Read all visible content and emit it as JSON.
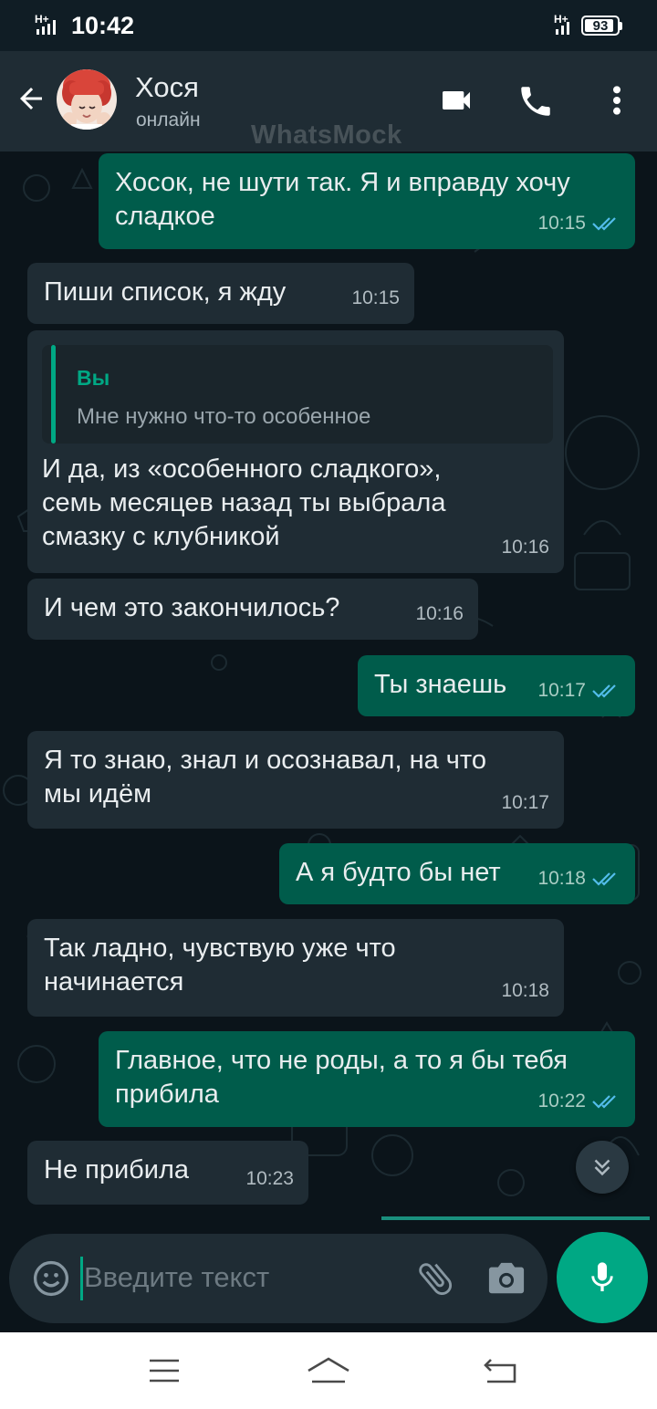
{
  "status_bar": {
    "time": "10:42",
    "network_left": "H+",
    "network_right": "H+",
    "battery": "93",
    "battery_level": 0.93
  },
  "header": {
    "contact_name": "Хося",
    "contact_status": "онлайн",
    "watermark": "WhatsMock"
  },
  "colors": {
    "header_bg": "#1f2c34",
    "chat_bg": "#0b141a",
    "incoming_bubble": "#1f2c34",
    "outgoing_bubble": "#005c4b",
    "accent": "#00a884",
    "read_ticks": "#53bdeb"
  },
  "messages": [
    {
      "direction": "out",
      "lines": [
        "Хосок, не шути так. Я и вправду хочу",
        "сладкое"
      ],
      "time": "10:15",
      "ticks": "double-check-read"
    },
    {
      "direction": "in",
      "lines": [
        "Пиши список, я жду"
      ],
      "time": "10:15"
    },
    {
      "direction": "in",
      "quote": {
        "author": "Вы",
        "text": "Мне нужно что-то особенное"
      },
      "lines": [
        "И да, из «особенного сладкого»,",
        "семь месяцев назад ты выбрала",
        "смазку с клубникой"
      ],
      "time": "10:16"
    },
    {
      "direction": "in",
      "lines": [
        "И чем это закончилось?"
      ],
      "time": "10:16"
    },
    {
      "direction": "out",
      "lines": [
        "Ты знаешь"
      ],
      "time": "10:17",
      "ticks": "double-check-read"
    },
    {
      "direction": "in",
      "lines": [
        "Я то знаю, знал и осознавал, на что",
        "мы идём"
      ],
      "time": "10:17"
    },
    {
      "direction": "out",
      "lines": [
        "А я будто бы нет"
      ],
      "time": "10:18",
      "ticks": "double-check-read"
    },
    {
      "direction": "in",
      "lines": [
        "Так ладно, чувствую уже что",
        "начинается"
      ],
      "time": "10:18"
    },
    {
      "direction": "out",
      "lines": [
        "Главное, что не роды, а то я бы тебя",
        "прибила"
      ],
      "time": "10:22",
      "ticks": "double-check-read"
    },
    {
      "direction": "in",
      "lines": [
        "Не прибила"
      ],
      "time": "10:23"
    }
  ],
  "composer": {
    "placeholder": "Введите текст"
  },
  "icons": {
    "back": "arrow-left-icon",
    "video": "video-call-icon",
    "call": "phone-icon",
    "menu": "more-vert-icon",
    "emoji": "emoji-icon",
    "attach": "paperclip-icon",
    "camera": "camera-icon",
    "mic": "mic-icon",
    "scroll": "chevron-double-down-icon",
    "nav_menu": "menu-icon",
    "nav_home": "home-icon",
    "nav_back": "back-icon"
  }
}
